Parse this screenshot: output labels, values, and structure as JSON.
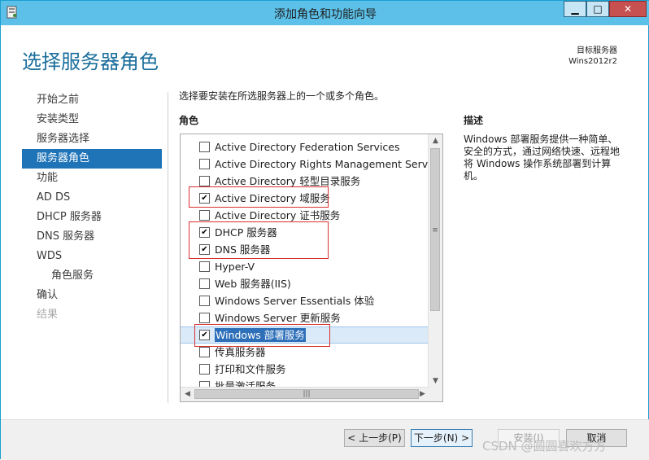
{
  "window": {
    "title": "添加角色和功能向导"
  },
  "header": {
    "page_title": "选择服务器角色",
    "target_label": "目标服务器",
    "target_server": "Wins2012r2"
  },
  "nav": {
    "items": [
      {
        "label": "开始之前",
        "state": "normal"
      },
      {
        "label": "安装类型",
        "state": "normal"
      },
      {
        "label": "服务器选择",
        "state": "normal"
      },
      {
        "label": "服务器角色",
        "state": "active"
      },
      {
        "label": "功能",
        "state": "normal"
      },
      {
        "label": "AD DS",
        "state": "normal"
      },
      {
        "label": "DHCP 服务器",
        "state": "normal"
      },
      {
        "label": "DNS 服务器",
        "state": "normal"
      },
      {
        "label": "WDS",
        "state": "normal"
      },
      {
        "label": "角色服务",
        "state": "sub"
      },
      {
        "label": "确认",
        "state": "normal"
      },
      {
        "label": "结果",
        "state": "disabled"
      }
    ]
  },
  "main": {
    "instruction": "选择要安装在所选服务器上的一个或多个角色。",
    "roles_label": "角色",
    "roles": [
      {
        "label": "Active Directory Federation Services",
        "checked": false
      },
      {
        "label": "Active Directory Rights Management Services",
        "checked": false
      },
      {
        "label": "Active Directory 轻型目录服务",
        "checked": false
      },
      {
        "label": "Active Directory 域服务",
        "checked": true
      },
      {
        "label": "Active Directory 证书服务",
        "checked": false
      },
      {
        "label": "DHCP 服务器",
        "checked": true
      },
      {
        "label": "DNS 服务器",
        "checked": true
      },
      {
        "label": "Hyper-V",
        "checked": false
      },
      {
        "label": "Web 服务器(IIS)",
        "checked": false
      },
      {
        "label": "Windows Server Essentials 体验",
        "checked": false
      },
      {
        "label": "Windows Server 更新服务",
        "checked": false
      },
      {
        "label": "Windows 部署服务",
        "checked": true,
        "selected": true
      },
      {
        "label": "传真服务器",
        "checked": false
      },
      {
        "label": "打印和文件服务",
        "checked": false
      },
      {
        "label": "批量激活服务",
        "checked": false
      }
    ]
  },
  "description": {
    "label": "描述",
    "text": "Windows 部署服务提供一种简单、安全的方式，通过网络快速、远程地将 Windows 操作系统部署到计算机。"
  },
  "buttons": {
    "previous": "< 上一步(P)",
    "next": "下一步(N) >",
    "install": "安装(I)",
    "cancel": "取消"
  },
  "watermark": "CSDN @圆圆喜欢方方",
  "colors": {
    "accent": "#1f74b8",
    "titlebar": "#5cc0e8",
    "title_text": "#1a6e9c",
    "highlight_box": "#d83030"
  }
}
